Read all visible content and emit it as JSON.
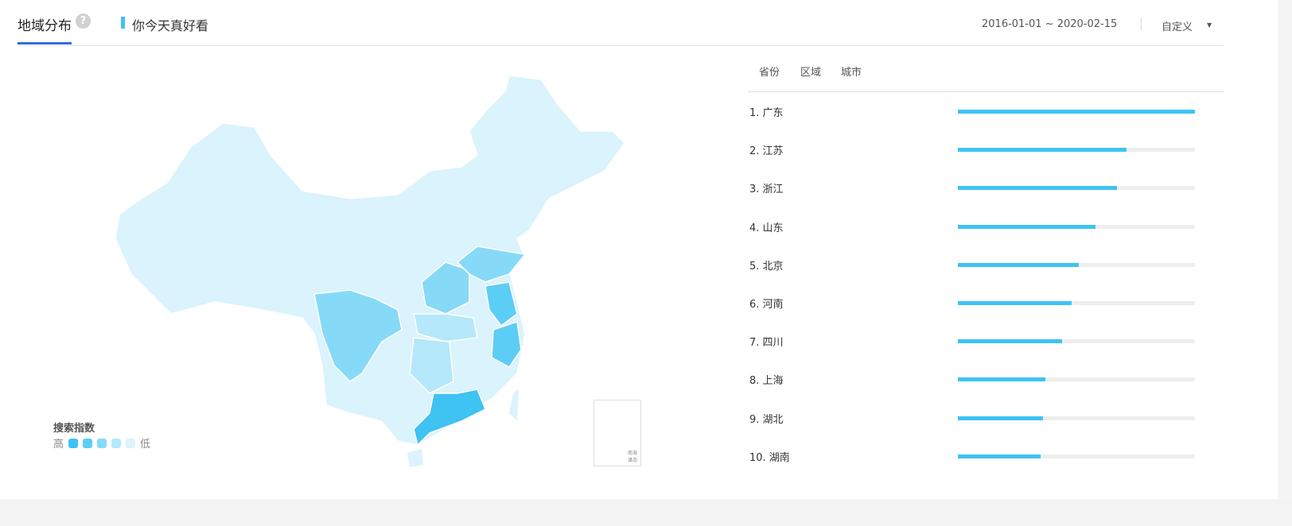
{
  "header": {
    "tab_label": "地域分布",
    "help_icon": "?",
    "keyword": "你今天真好看",
    "date_range": "2016-01-01 ~ 2020-02-15",
    "range_select": "自定义"
  },
  "panel": {
    "tabs": [
      "省份",
      "区域",
      "城市"
    ],
    "ranking": [
      {
        "label": "1.  广东",
        "value": 100
      },
      {
        "label": "2.  江苏",
        "value": 71
      },
      {
        "label": "3.  浙江",
        "value": 67
      },
      {
        "label": "4.  山东",
        "value": 58
      },
      {
        "label": "5.  北京",
        "value": 51
      },
      {
        "label": "6.  河南",
        "value": 48
      },
      {
        "label": "7.  四川",
        "value": 44
      },
      {
        "label": "8.  上海",
        "value": 37
      },
      {
        "label": "9.  湖北",
        "value": 36
      },
      {
        "label": "10. 湖南",
        "value": 35
      }
    ]
  },
  "legend": {
    "title": "搜索指数",
    "high": "高",
    "low": "低",
    "colors": [
      "#3ec3f3",
      "#5ccdf4",
      "#86daf7",
      "#b5e8fa",
      "#daf3fc"
    ]
  },
  "inset": {
    "label_line1": "南海",
    "label_line2": "诸岛"
  }
}
